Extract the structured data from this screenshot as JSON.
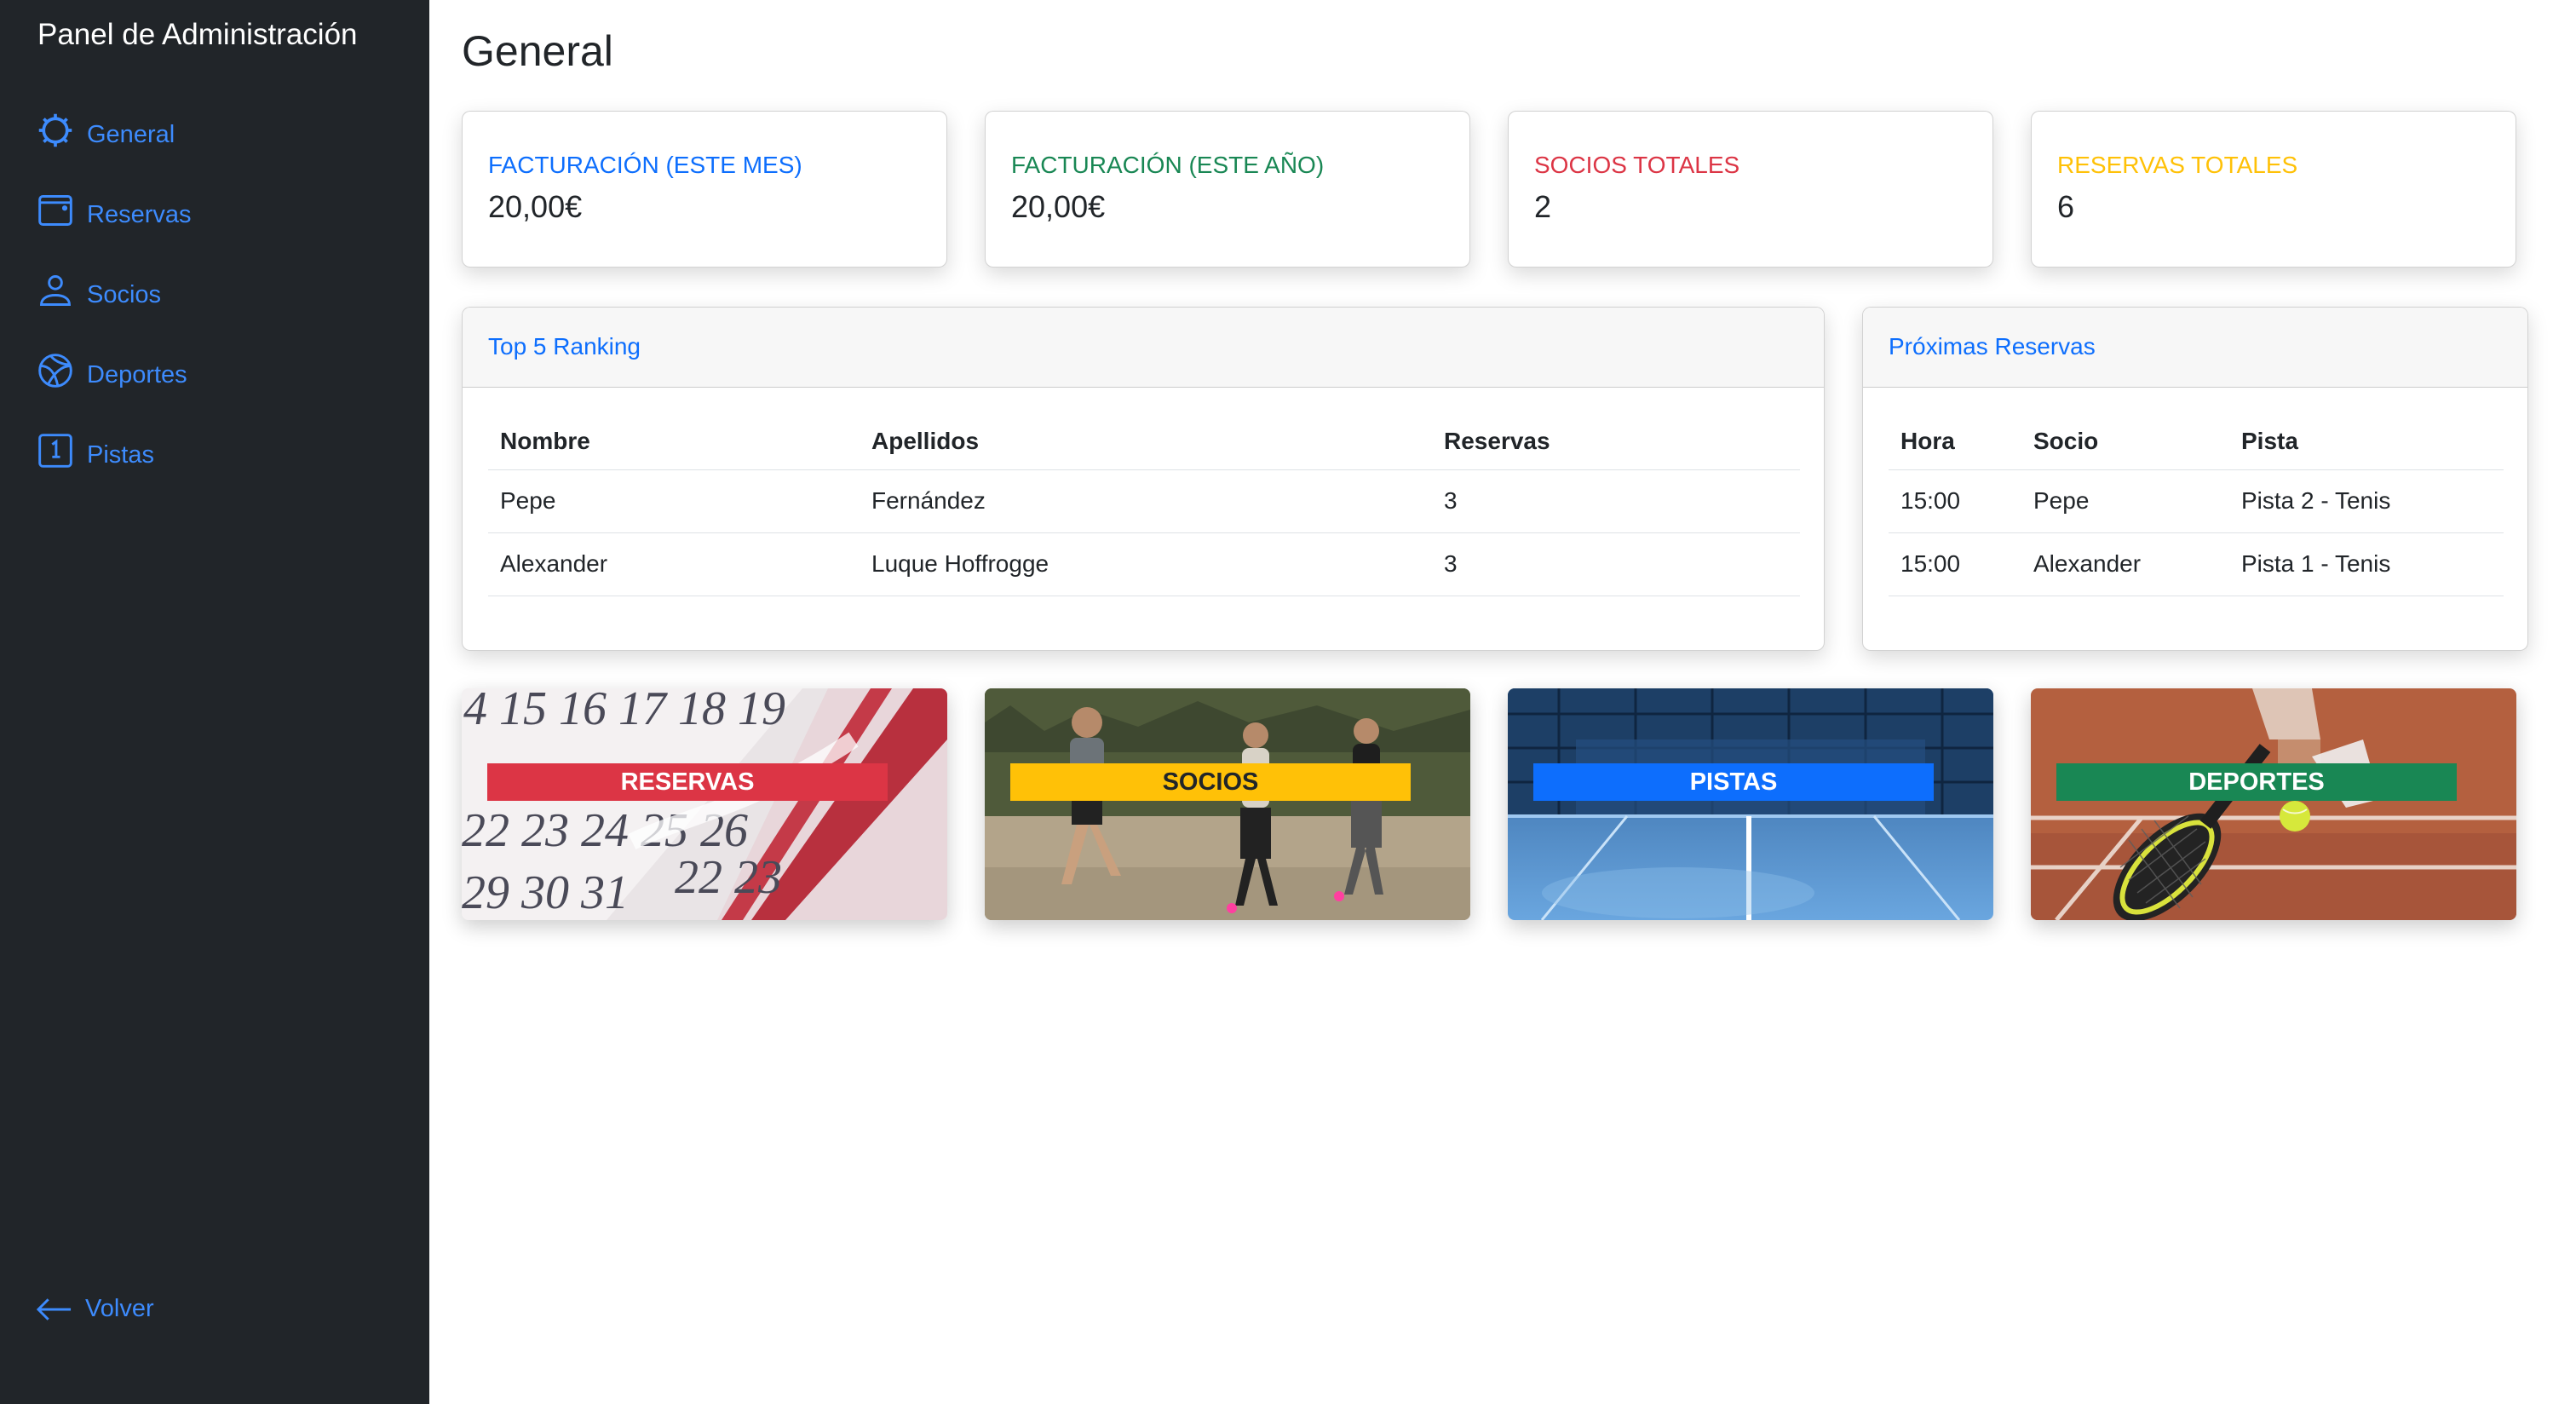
{
  "sidebar": {
    "brand": "Panel de Administración",
    "items": [
      {
        "label": "General",
        "icon": "gear-icon"
      },
      {
        "label": "Reservas",
        "icon": "calendar-icon"
      },
      {
        "label": "Socios",
        "icon": "person-icon"
      },
      {
        "label": "Deportes",
        "icon": "ball-icon"
      },
      {
        "label": "Pistas",
        "icon": "court-number-icon"
      }
    ],
    "back_label": "Volver",
    "accent": "#3d8bfd",
    "background": "#212529"
  },
  "main": {
    "title": "General",
    "stats": [
      {
        "label": "Facturación (este mes)",
        "value": "20,00€",
        "color": "#0d6efd"
      },
      {
        "label": "Facturación (este año)",
        "value": "20,00€",
        "color": "#198754"
      },
      {
        "label": "Socios totales",
        "value": "2",
        "color": "#dc3545"
      },
      {
        "label": "Reservas totales",
        "value": "6",
        "color": "#ffc107"
      }
    ],
    "ranking": {
      "title": "Top 5 Ranking",
      "columns": [
        "Nombre",
        "Apellidos",
        "Reservas"
      ],
      "rows": [
        [
          "Pepe",
          "Fernández",
          "3"
        ],
        [
          "Alexander",
          "Luque Hoffrogge",
          "3"
        ]
      ]
    },
    "upcoming": {
      "title": "Próximas Reservas",
      "columns": [
        "Hora",
        "Socio",
        "Pista"
      ],
      "rows": [
        [
          "15:00",
          "Pepe",
          "Pista 2 - Tenis"
        ],
        [
          "15:00",
          "Alexander",
          "Pista 1 - Tenis"
        ]
      ]
    },
    "tiles": [
      {
        "label": "RESERVAS",
        "color": "#dc3545"
      },
      {
        "label": "SOCIOS",
        "color": "#ffc107"
      },
      {
        "label": "PISTAS",
        "color": "#0d6efd"
      },
      {
        "label": "DEPORTES",
        "color": "#198754"
      }
    ]
  }
}
